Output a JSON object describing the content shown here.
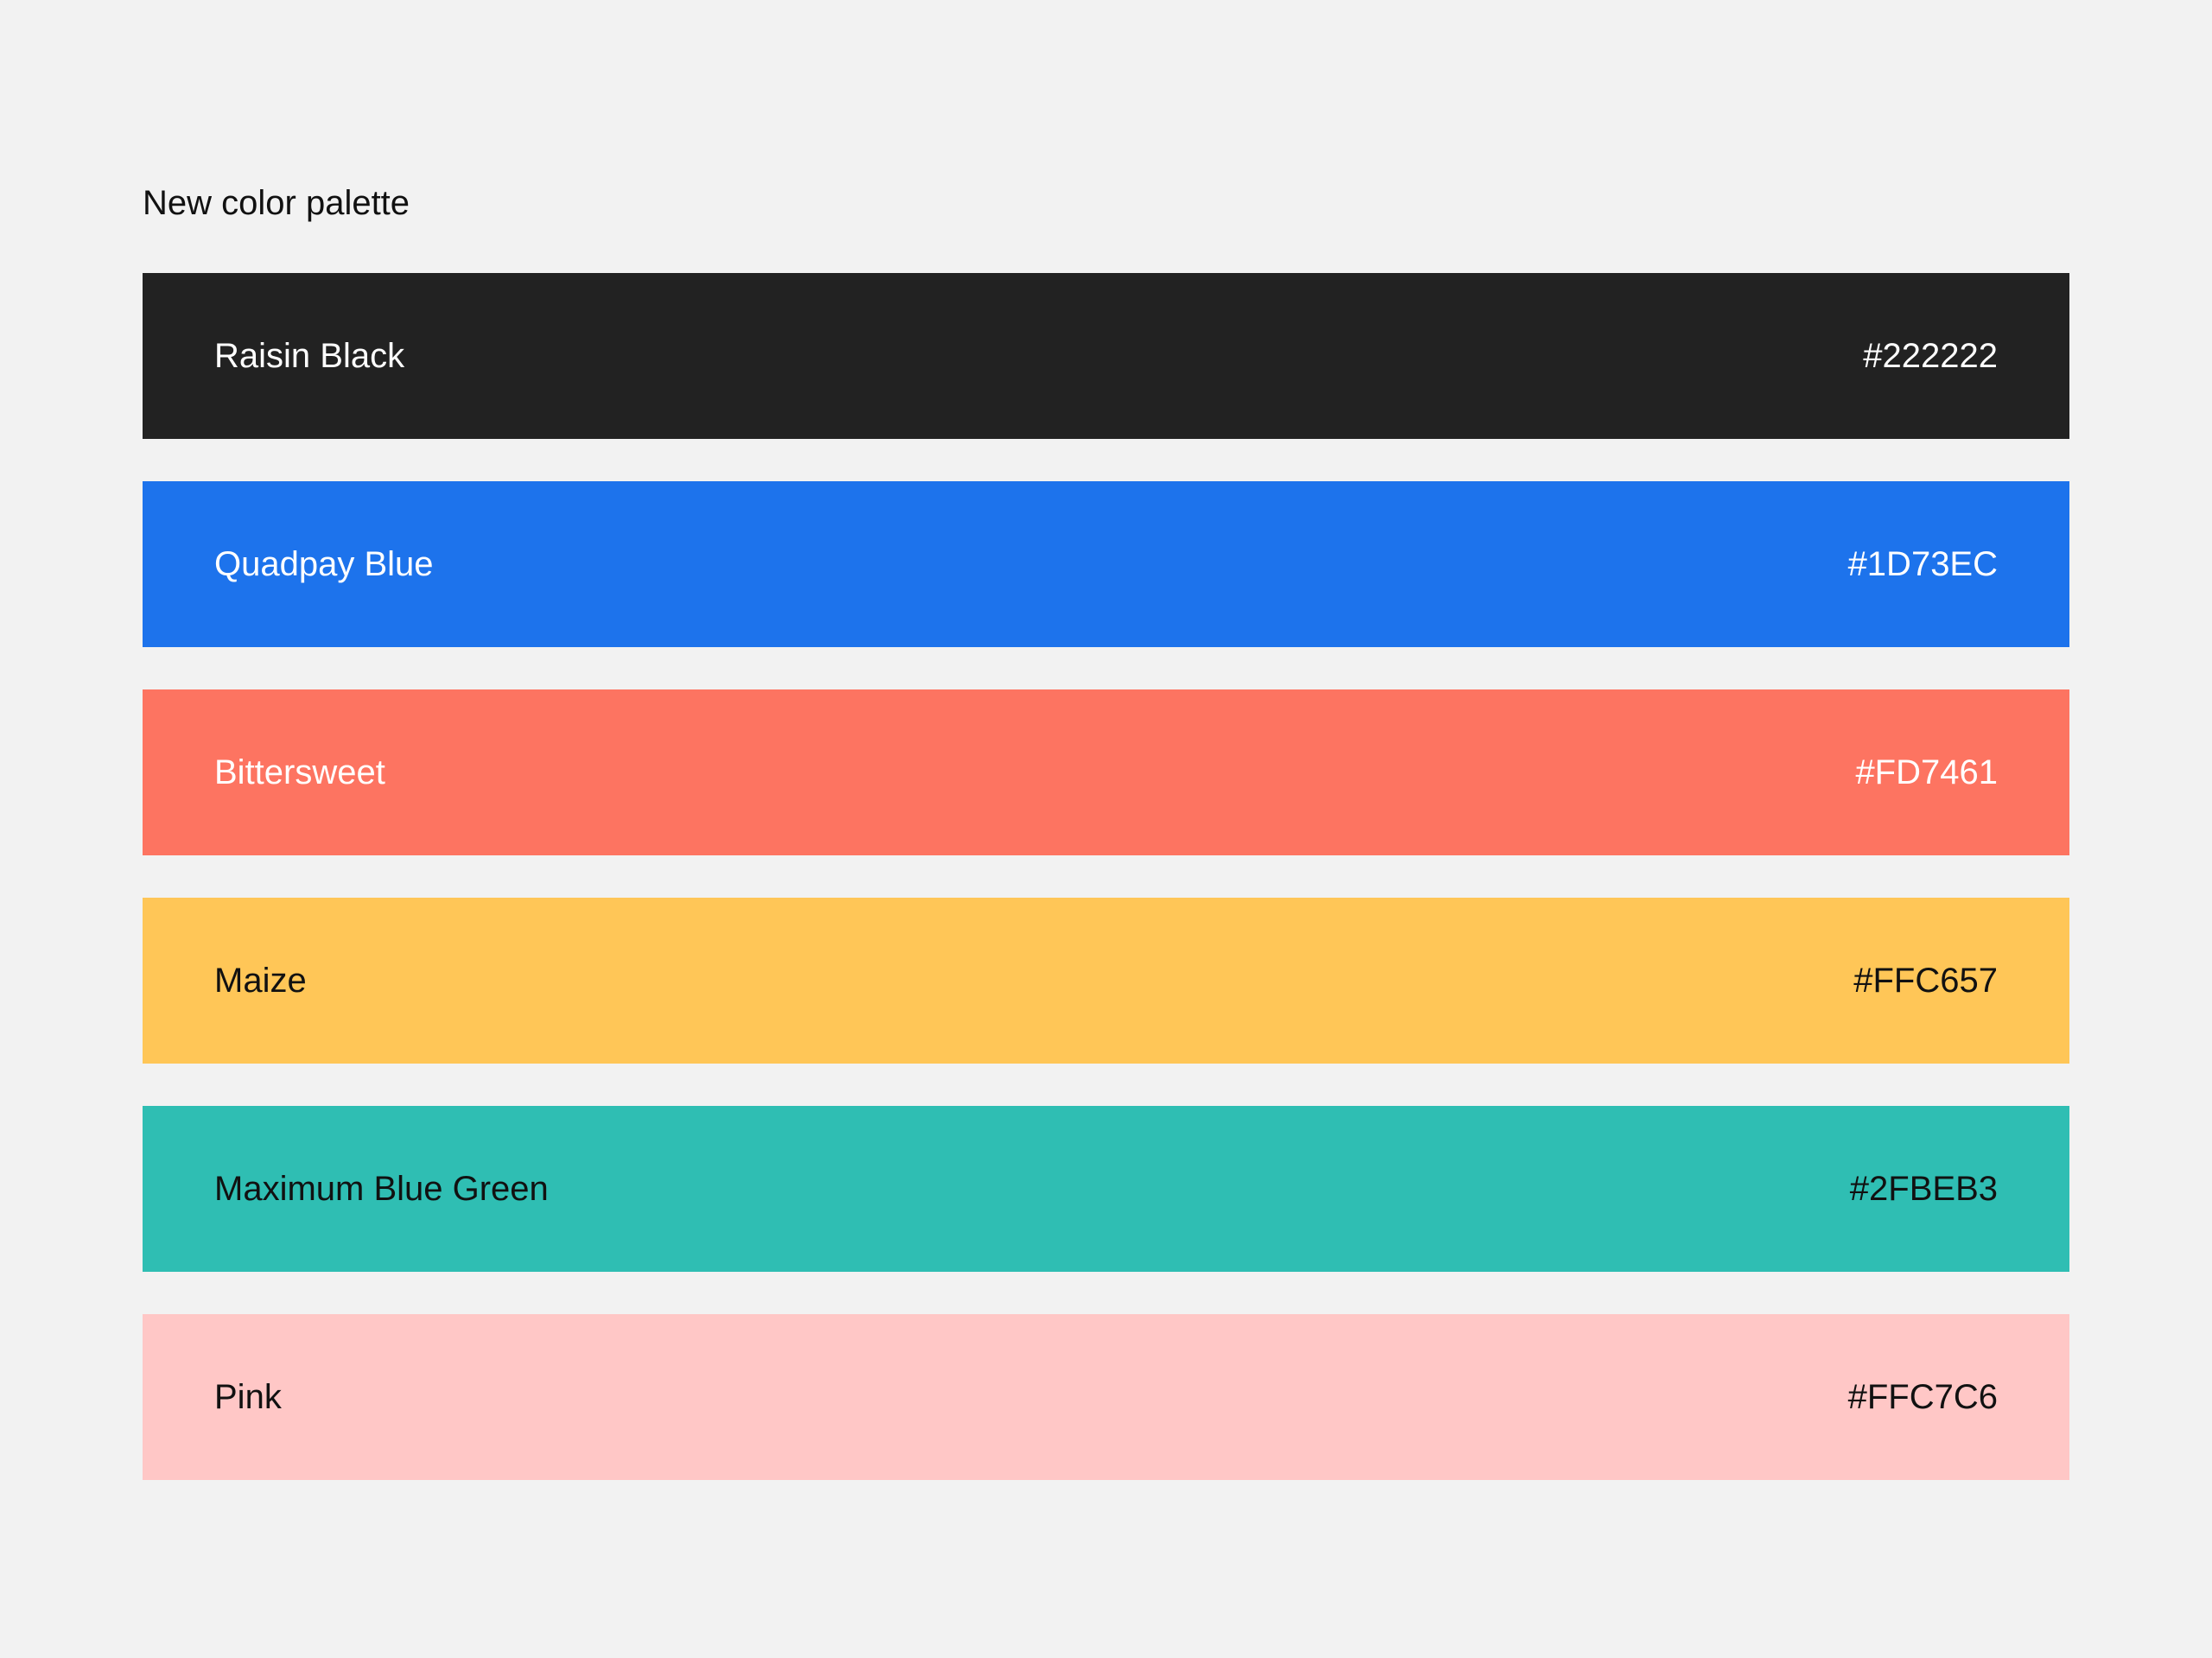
{
  "title": "New color palette",
  "swatches": [
    {
      "name": "Raisin Black",
      "hex": "#222222",
      "color": "#222222",
      "text_color": "#FFFFFF"
    },
    {
      "name": "Quadpay Blue",
      "hex": "#1D73EC",
      "color": "#1D73EC",
      "text_color": "#FFFFFF"
    },
    {
      "name": "Bittersweet",
      "hex": "#FD7461",
      "color": "#FD7461",
      "text_color": "#FFFFFF"
    },
    {
      "name": "Maize",
      "hex": "#FFC657",
      "color": "#FFC657",
      "text_color": "#111111"
    },
    {
      "name": "Maximum Blue Green",
      "hex": "#2FBEB3",
      "color": "#2FBEB3",
      "text_color": "#111111"
    },
    {
      "name": "Pink",
      "hex": "#FFC7C6",
      "color": "#FFC7C6",
      "text_color": "#111111"
    }
  ]
}
